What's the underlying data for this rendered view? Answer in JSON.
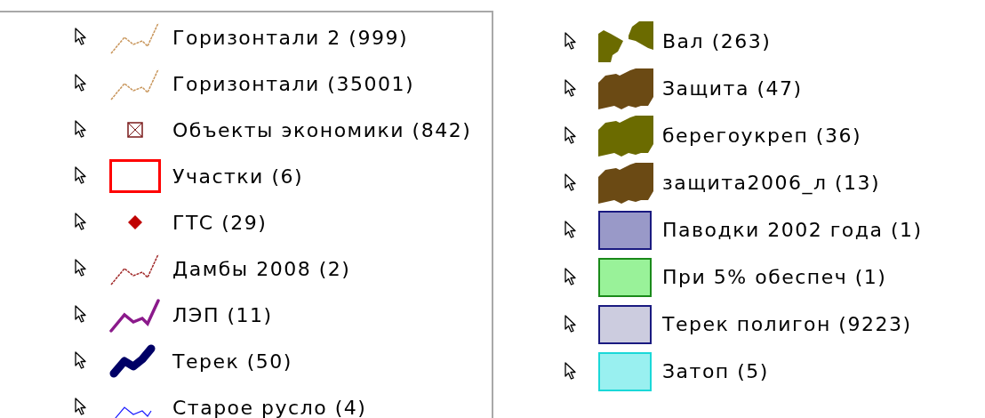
{
  "legend_left": [
    {
      "label": "Горизонтали 2 (999)",
      "kind": "dashed_line",
      "color": "#c8955a"
    },
    {
      "label": "Горизонтали (35001)",
      "kind": "dashed_line",
      "color": "#c8955a"
    },
    {
      "label": "Объекты экономики (842)",
      "kind": "crossed_box",
      "color": "#7a1a1a"
    },
    {
      "label": "Участки (6)",
      "kind": "outline_rect",
      "color": "#ff0000"
    },
    {
      "label": "ГТС (29)",
      "kind": "diamond",
      "color": "#c00000"
    },
    {
      "label": "Дамбы 2008 (2)",
      "kind": "dashed_line",
      "color": "#a02828"
    },
    {
      "label": "ЛЭП (11)",
      "kind": "medium_line",
      "color": "#8b1a8b"
    },
    {
      "label": "Терек (50)",
      "kind": "thick_line",
      "color": "#000066"
    },
    {
      "label": "Старое русло (4)",
      "kind": "thin_line",
      "color": "#1a1aff"
    }
  ],
  "legend_right": [
    {
      "label": "Вал (263)",
      "kind": "split_polygon",
      "color": "#6b6b00"
    },
    {
      "label": "Защита (47)",
      "kind": "polygon",
      "color": "#6b4a14"
    },
    {
      "label": "берегоукреп (36)",
      "kind": "polygon",
      "color": "#6b6b00"
    },
    {
      "label": "защита2006_л (13)",
      "kind": "polygon",
      "color": "#6b4a14"
    },
    {
      "label": "Паводки 2002 года (1)",
      "kind": "fill_rect",
      "color": "#9999c8",
      "outline": {
        "color": "#1a1a80"
      }
    },
    {
      "label": "При 5% обеспеч (1)",
      "kind": "fill_rect",
      "color": "#99f299",
      "outline": {
        "color": "#1a8a1a"
      }
    },
    {
      "label": "Терек полигон (9223)",
      "kind": "fill_rect",
      "color": "#ccccdf",
      "outline": {
        "color": "#1a1a80"
      }
    },
    {
      "label": "Затоп (5)",
      "kind": "fill_rect",
      "color": "#99f0f0",
      "outline": {
        "color": "#1ad8d8"
      }
    }
  ]
}
